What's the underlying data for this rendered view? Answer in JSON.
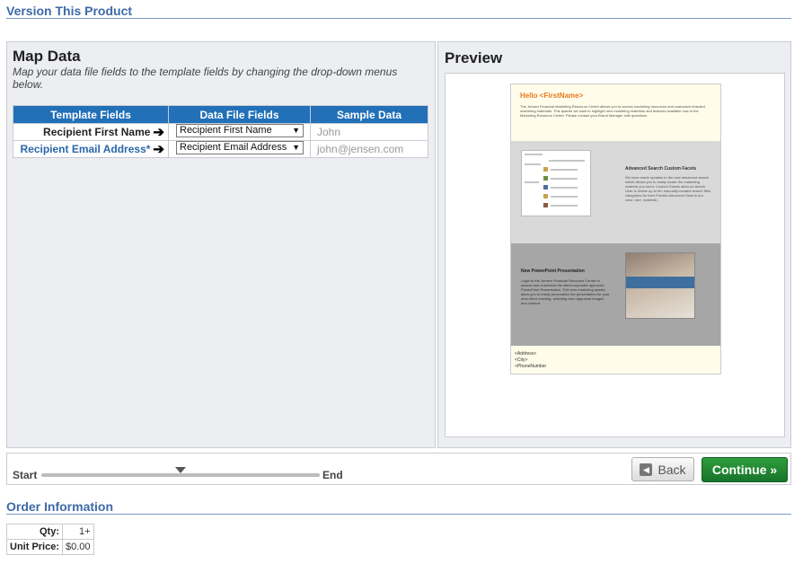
{
  "header": {
    "version_title": "Version This Product"
  },
  "map": {
    "title": "Map Data",
    "description": "Map your data file fields to the template fields by changing the drop-down menus below.",
    "columns": [
      "Template Fields",
      "Data File Fields",
      "Sample Data"
    ],
    "rows": [
      {
        "template_field": "Recipient First Name",
        "data_field": "Recipient First Name",
        "sample": "John",
        "required": false
      },
      {
        "template_field": "Recipient Email Address*",
        "data_field": "Recipient Email Address",
        "sample": "john@jensen.com",
        "required": true
      }
    ]
  },
  "preview": {
    "title": "Preview",
    "doc": {
      "hello": "Hello <FirstName>",
      "intro": "The Jensen Financial Marketing Resource Center allows you to access marketing resources and customize branded marketing materials. This quarter we want to highlight new marketing materials and features available now in the Marketing Resource Center. Please contact your Brand Manager with questions.",
      "feature1_title": "Advanced Search Custom Facets",
      "feature1_text": "We have made updates to the new advanced search which allows you to easily locate the marketing material you need. Custom Facets allow an Admin User to define up to ten manually-created search filter categories for their Portal's Advanced Search (ex: color, size, material).",
      "feature2_title": "New PowerPoint Presentation",
      "feature2_text": "Login to the Jensen Financial Resource Center to access and customize the latest corporate approved PowerPoint Presentation. This new marketing assets allow you to easily personalize the presentation for your next client meeting, selecting from approved images and content.",
      "address_lines": [
        "<Address>",
        "<City>",
        "<PhoneNumber"
      ]
    }
  },
  "nav": {
    "start_label": "Start",
    "end_label": "End",
    "progress": 0.5,
    "back_label": "Back",
    "continue_label": "Continue »"
  },
  "order": {
    "title": "Order Information",
    "qty_label": "Qty:",
    "qty_value": "1+",
    "unit_price_label": "Unit Price:",
    "unit_price_value": "$0.00"
  }
}
